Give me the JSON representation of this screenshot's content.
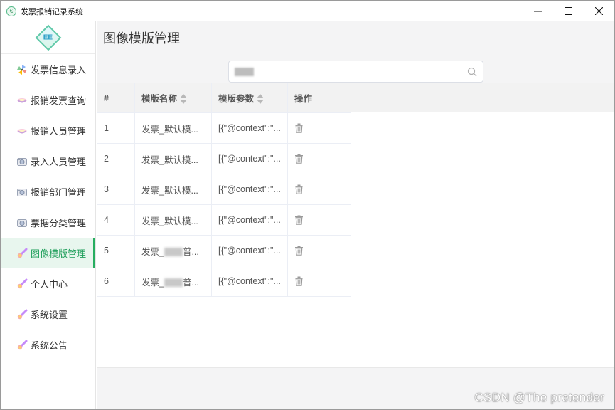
{
  "window": {
    "title": "发票报销记录系统",
    "controls": {
      "minimize": "—",
      "maximize": "☐",
      "close": "✕"
    }
  },
  "logo": {
    "text": "EE"
  },
  "sidebar": {
    "items": [
      {
        "label": "发票信息录入",
        "icon": "pinwheel-icon",
        "active": false
      },
      {
        "label": "报销发票查询",
        "icon": "cake-icon",
        "active": false
      },
      {
        "label": "报销人员管理",
        "icon": "cake-icon",
        "active": false
      },
      {
        "label": "录入人员管理",
        "icon": "camera-icon",
        "active": false
      },
      {
        "label": "报销部门管理",
        "icon": "camera-icon",
        "active": false
      },
      {
        "label": "票据分类管理",
        "icon": "camera-icon",
        "active": false
      },
      {
        "label": "图像模版管理",
        "icon": "comet-icon",
        "active": true
      },
      {
        "label": "个人中心",
        "icon": "comet-icon",
        "active": false
      },
      {
        "label": "系统设置",
        "icon": "comet-icon",
        "active": false
      },
      {
        "label": "系统公告",
        "icon": "comet-icon",
        "active": false
      }
    ]
  },
  "main": {
    "title": "图像模版管理",
    "search": {
      "value": "",
      "placeholder": ""
    },
    "table": {
      "columns": [
        "#",
        "模版名称",
        "模版参数",
        "操作"
      ],
      "rows": [
        {
          "index": "1",
          "name": "发票_默认模...",
          "name_prefix": "",
          "name_suffix": "",
          "params": "[{\"@context\":\"..."
        },
        {
          "index": "2",
          "name": "发票_默认模...",
          "name_prefix": "",
          "name_suffix": "",
          "params": "[{\"@context\":\"..."
        },
        {
          "index": "3",
          "name": "发票_默认模...",
          "name_prefix": "",
          "name_suffix": "",
          "params": "[{\"@context\":\"..."
        },
        {
          "index": "4",
          "name": "发票_默认模...",
          "name_prefix": "",
          "name_suffix": "",
          "params": "[{\"@context\":\"..."
        },
        {
          "index": "5",
          "name": "",
          "name_prefix": "发票_",
          "name_suffix": "普...",
          "params": "[{\"@context\":\"..."
        },
        {
          "index": "6",
          "name": "",
          "name_prefix": "发票_",
          "name_suffix": "普...",
          "params": "[{\"@context\":\"..."
        }
      ]
    }
  },
  "watermark": "CSDN @The  pretender",
  "colors": {
    "accent": "#27ae60",
    "active_bg": "#e8f6ee"
  }
}
